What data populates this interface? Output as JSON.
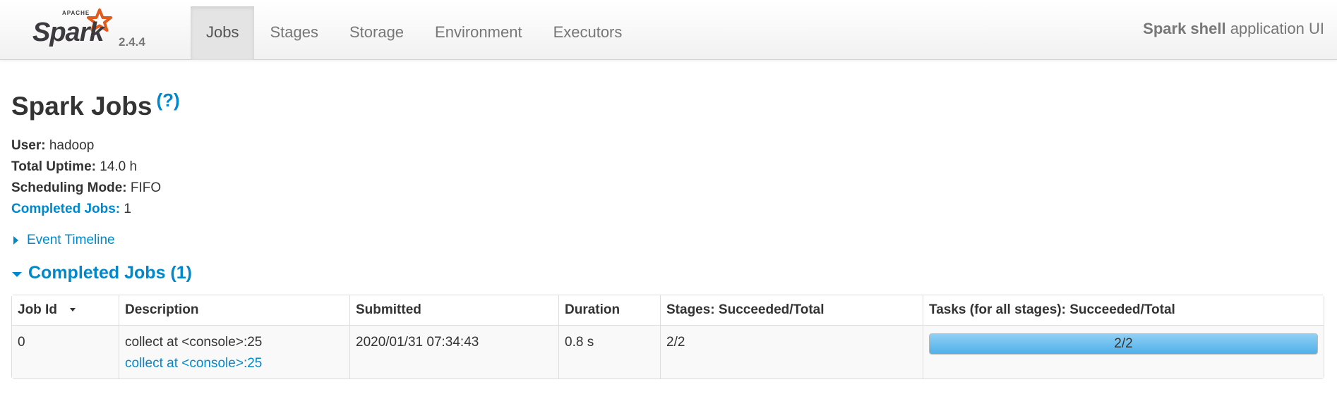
{
  "navbar": {
    "brand_name": "Spark",
    "brand_prefix": "APACHE",
    "version": "2.4.4",
    "tabs": [
      {
        "label": "Jobs",
        "active": true
      },
      {
        "label": "Stages",
        "active": false
      },
      {
        "label": "Storage",
        "active": false
      },
      {
        "label": "Environment",
        "active": false
      },
      {
        "label": "Executors",
        "active": false
      }
    ],
    "app_name_bold": "Spark shell",
    "app_name_suffix": "application UI"
  },
  "page": {
    "title": "Spark Jobs",
    "help_link": "(?)"
  },
  "summary": {
    "user_label": "User:",
    "user_value": "hadoop",
    "uptime_label": "Total Uptime:",
    "uptime_value": "14.0 h",
    "scheduling_label": "Scheduling Mode:",
    "scheduling_value": "FIFO",
    "completed_label": "Completed Jobs:",
    "completed_value": "1"
  },
  "event_timeline_label": "Event Timeline",
  "completed_jobs_section": {
    "title": "Completed Jobs (1)",
    "columns": [
      "Job Id",
      "Description",
      "Submitted",
      "Duration",
      "Stages: Succeeded/Total",
      "Tasks (for all stages): Succeeded/Total"
    ],
    "rows": [
      {
        "job_id": "0",
        "description": "collect at <console>:25",
        "description_link": "collect at <console>:25",
        "submitted": "2020/01/31 07:34:43",
        "duration": "0.8 s",
        "stages": "2/2",
        "tasks": "2/2",
        "tasks_progress": 1.0
      }
    ]
  },
  "colors": {
    "link": "#0088cc",
    "progress_fill": "#4fb0ea",
    "logo_star": "#e25a1c"
  }
}
